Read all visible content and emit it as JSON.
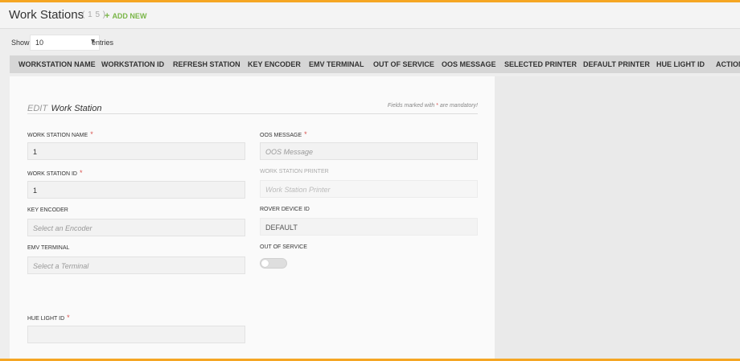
{
  "header": {
    "title": "Work Stations",
    "count": "( 1 5 )",
    "add_new": "ADD NEW"
  },
  "length_menu": {
    "show_label": "Show",
    "selected": "10",
    "entries_label": "entries"
  },
  "table": {
    "columns": [
      "WORKSTATION NAME",
      "WORKSTATION ID",
      "REFRESH STATION",
      "KEY ENCODER",
      "EMV TERMINAL",
      "OUT OF SERVICE",
      "OOS MESSAGE",
      "SELECTED PRINTER",
      "DEFAULT PRINTER",
      "HUE LIGHT ID",
      "ACTION"
    ]
  },
  "form": {
    "edit_label": "EDIT",
    "entity_label": "Work Station",
    "mandatory_note": "Fields marked with",
    "mandatory_star": "*",
    "mandatory_suffix": "are mandatory!",
    "fields": {
      "work_station_name": {
        "label": "WORK STATION NAME",
        "value": "1",
        "required": true
      },
      "work_station_id": {
        "label": "WORK STATION ID",
        "value": "1",
        "required": true
      },
      "key_encoder": {
        "label": "KEY ENCODER",
        "placeholder": "Select an Encoder"
      },
      "emv_terminal": {
        "label": "EMV TERMINAL",
        "placeholder": "Select a Terminal"
      },
      "hue_light_id": {
        "label": "HUE LIGHT ID",
        "value": "",
        "required": true
      },
      "oos_message": {
        "label": "OOS MESSAGE",
        "placeholder": "OOS Message",
        "required": true
      },
      "work_station_printer": {
        "label": "WORK STATION PRINTER",
        "placeholder": "Work Station Printer"
      },
      "rover_device_id": {
        "label": "ROVER DEVICE ID",
        "value": "DEFAULT"
      },
      "out_of_service": {
        "label": "OUT OF SERVICE",
        "on": false
      }
    }
  },
  "colors": {
    "accent": "#f5a623",
    "add_new": "#7ab648",
    "required_star": "#d9534f"
  }
}
